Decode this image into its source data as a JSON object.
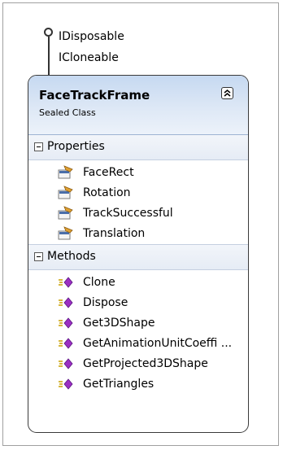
{
  "interfaces": [
    "IDisposable",
    "ICloneable"
  ],
  "class": {
    "name": "FaceTrackFrame",
    "kind": "Sealed Class"
  },
  "sections": {
    "properties": {
      "label": "Properties",
      "items": [
        "FaceRect",
        "Rotation",
        "TrackSuccessful",
        "Translation"
      ]
    },
    "methods": {
      "label": "Methods",
      "items": [
        "Clone",
        "Dispose",
        "Get3DShape",
        "GetAnimationUnitCoeffi ...",
        "GetProjected3DShape",
        "GetTriangles"
      ]
    }
  }
}
